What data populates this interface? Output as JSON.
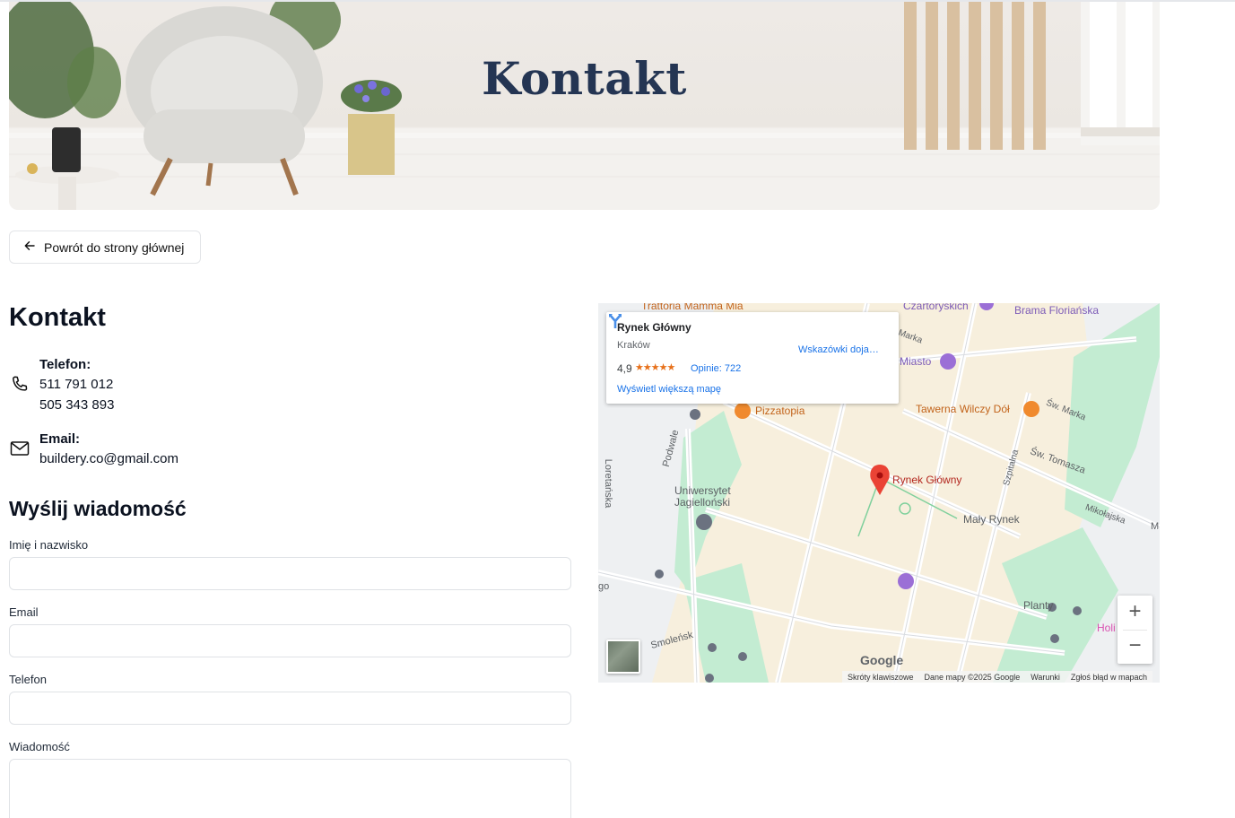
{
  "hero": {
    "title": "Kontakt"
  },
  "nav": {
    "back_label": "Powrót do strony głównej"
  },
  "contact": {
    "title": "Kontakt",
    "phone_label": "Telefon:",
    "phones": [
      "511 791 012",
      "505 343 893"
    ],
    "email_label": "Email:",
    "email": "buildery.co@gmail.com"
  },
  "form": {
    "title": "Wyślij wiadomość",
    "name_label": "Imię i nazwisko",
    "email_label": "Email",
    "phone_label": "Telefon",
    "message_label": "Wiadomość",
    "name_value": "",
    "email_value": "",
    "phone_value": "",
    "message_value": ""
  },
  "map": {
    "place_card": {
      "name": "Rynek Główny",
      "city": "Kraków",
      "rating": "4,9",
      "stars": "★★★★★",
      "reviews": "Opinie: 722",
      "directions": "Wskazówki doja…",
      "bigger_map": "Wyświetl większą mapę"
    },
    "labels": {
      "trattoria": "Trattoria Mamma Mia",
      "czartoryskich": "Czartoryskich",
      "brama": "Brama Floriańska",
      "miasto": "Miasto",
      "marka": "Marka",
      "pizzatopia": "Pizzatopia",
      "tawerna": "Tawerna Wilczy Dół",
      "sw_marka": "Św. Marka",
      "podwale": "Podwale",
      "loretanska": "Loretańska",
      "szpitalna": "Szpitalna",
      "sw_tomasza": "Św. Tomasza",
      "rynek": "Rynek Główny",
      "uniwersytet_1": "Uniwersytet",
      "uniwersytet_2": "Jagielloński",
      "maly_rynek": "Mały Rynek",
      "mikolajska": "Mikołajska",
      "planty": "Planty",
      "holi": "Holi",
      "smolensk": "Smoleńsk",
      "go": "go",
      "m": "M"
    },
    "google": "Google",
    "footer": [
      "Skróty klawiszowe",
      "Dane mapy ©2025 Google",
      "Warunki",
      "Zgłoś błąd w mapach"
    ],
    "zoom_in": "+",
    "zoom_out": "−"
  },
  "colors": {
    "text_dark": "#0b1220",
    "hero_title": "#243553",
    "map_park": "#c3ecd2",
    "map_land": "#f7efdd",
    "link_blue": "#1a73e8",
    "marker_red": "#ea4335"
  }
}
